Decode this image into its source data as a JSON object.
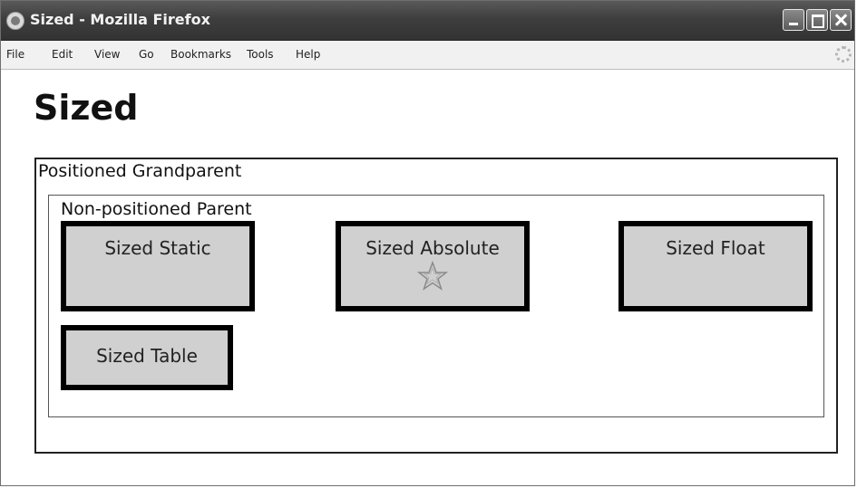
{
  "window": {
    "title": "Sized - Mozilla Firefox",
    "app_icon": "firefox-icon",
    "controls": [
      "minimize-icon",
      "maximize-icon",
      "close-icon"
    ]
  },
  "menubar": {
    "items": [
      "File",
      "Edit",
      "View",
      "Go",
      "Bookmarks",
      "Tools",
      "Help"
    ]
  },
  "page": {
    "heading": "Sized",
    "grandparent_label": "Positioned Grandparent",
    "parent_label": "Non-positioned Parent",
    "boxes": {
      "static": "Sized Static",
      "absolute": "Sized Absolute",
      "float": "Sized Float",
      "table": "Sized Table"
    },
    "absolute_icon": "star-icon"
  },
  "colors": {
    "titlebar": "#3e3e3e",
    "box_fill": "#d0d0d0",
    "box_border": "#000000"
  }
}
